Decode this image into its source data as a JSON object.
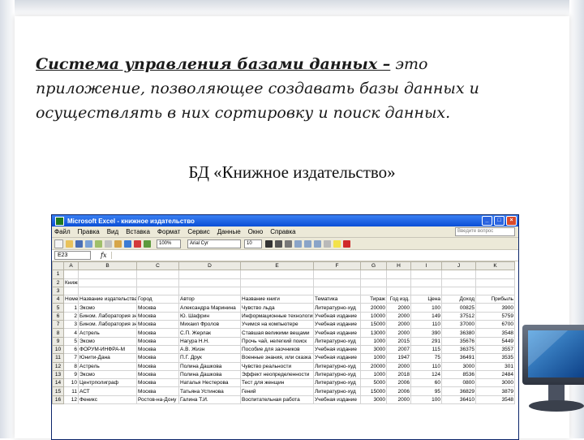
{
  "slide": {
    "definition_term": "Система управления базами данных –",
    "definition_text": " это приложение, позволяющее создавать базы данных и осуществлять в них сортировку и поиск данных.",
    "subtitle": "БД «Книжное издательство»"
  },
  "excel": {
    "title": "Microsoft Excel - книжное издательство",
    "menu": [
      "Файл",
      "Правка",
      "Вид",
      "Вставка",
      "Формат",
      "Сервис",
      "Данные",
      "Окно",
      "Справка"
    ],
    "help_placeholder": "Введите вопрос",
    "font_name": "Arial Cyr",
    "font_size": "10",
    "zoom": "100%",
    "name_box": "E23",
    "fx": "fx",
    "columns": [
      "A",
      "B",
      "C",
      "D",
      "E",
      "F",
      "G",
      "H",
      "I",
      "J",
      "K"
    ],
    "rows": [
      {
        "n": "1",
        "cells": [
          "",
          "",
          "",
          "",
          "",
          "",
          "",
          "",
          "",
          "",
          ""
        ]
      },
      {
        "n": "2",
        "cells": [
          "Книжное издательство",
          "",
          "",
          "",
          "",
          "",
          "",
          "",
          "",
          "",
          ""
        ]
      },
      {
        "n": "3",
        "cells": [
          "",
          "",
          "",
          "",
          "",
          "",
          "",
          "",
          "",
          "",
          ""
        ]
      },
      {
        "n": "4",
        "cells": [
          "Номер",
          "Название издательства",
          "Город",
          "Автор",
          "Название книги",
          "Тематика",
          "Тираж",
          "Год изд.",
          "Цена",
          "Доход",
          "Прибыль"
        ]
      },
      {
        "n": "5",
        "cells": [
          "1",
          "Эксмо",
          "Москва",
          "Александра Маринина",
          "Чувство льда",
          "Литературно-худ",
          "20000",
          "2000",
          "100",
          "00825",
          "3900"
        ]
      },
      {
        "n": "6",
        "cells": [
          "2",
          "Бином. Лаборатория знаний",
          "Москва",
          "Ю. Шафрин",
          "Информационные технологии",
          "Учебная издание",
          "10000",
          "2000",
          "149",
          "37512",
          "5759"
        ]
      },
      {
        "n": "7",
        "cells": [
          "3",
          "Бином. Лаборатория знаний",
          "Москва",
          "Михаил Фролов",
          "Учимся на компьютере",
          "Учебная издание",
          "15000",
          "2000",
          "110",
          "37000",
          "6700"
        ]
      },
      {
        "n": "8",
        "cells": [
          "4",
          "Астрель",
          "Москва",
          "С.П. Жерлак",
          "Ставшая великими вещами",
          "Учебная издание",
          "13000",
          "2000",
          "390",
          "36380",
          "3548"
        ]
      },
      {
        "n": "9",
        "cells": [
          "5",
          "Эксмо",
          "Москва",
          "Нагура Н.Н.",
          "Прочь чай, нелегкий поиск",
          "Литературно-худ",
          "1000",
          "2015",
          "291",
          "35676",
          "5449"
        ]
      },
      {
        "n": "10",
        "cells": [
          "6",
          "ФОРУМ-ИНФРА-М",
          "Москва",
          "А.В. Жизн",
          "Пособие для заочников",
          "Учебная издание",
          "3000",
          "2007",
          "115",
          "36375",
          "3557"
        ]
      },
      {
        "n": "11",
        "cells": [
          "7",
          "Юнити-Дана",
          "Москва",
          "П.Г. Друк",
          "Военные знания, или сказка",
          "Учебная издание",
          "1000",
          "1947",
          "75",
          "36491",
          "3535"
        ]
      },
      {
        "n": "12",
        "cells": [
          "8",
          "Астрель",
          "Москва",
          "Полина Дашкова",
          "Чувство реальности",
          "Литературно-худ",
          "20000",
          "2000",
          "110",
          "3000",
          "301"
        ]
      },
      {
        "n": "13",
        "cells": [
          "9",
          "Эксмо",
          "Москва",
          "Полина Дашкова",
          "Эффект неопределенности",
          "Литературно-худ",
          "1000",
          "2018",
          "124",
          "8536",
          "2484"
        ]
      },
      {
        "n": "14",
        "cells": [
          "10",
          "Центрполиграф",
          "Москва",
          "Наталья Нестерова",
          "Тест для женщин",
          "Литературно-худ",
          "5000",
          "2006",
          "60",
          "0800",
          "3000"
        ]
      },
      {
        "n": "15",
        "cells": [
          "11",
          "АСТ",
          "Москва",
          "Татьяна Устинова",
          "Гений",
          "Литературно-худ",
          "15000",
          "2006",
          "95",
          "36829",
          "3879"
        ]
      },
      {
        "n": "16",
        "cells": [
          "12",
          "Феникс",
          "Ростов-на-Дону",
          "Галина Т.И.",
          "Воспитательная работа",
          "Учебная издание",
          "3000",
          "2000",
          "100",
          "36410",
          "3548"
        ]
      }
    ]
  }
}
